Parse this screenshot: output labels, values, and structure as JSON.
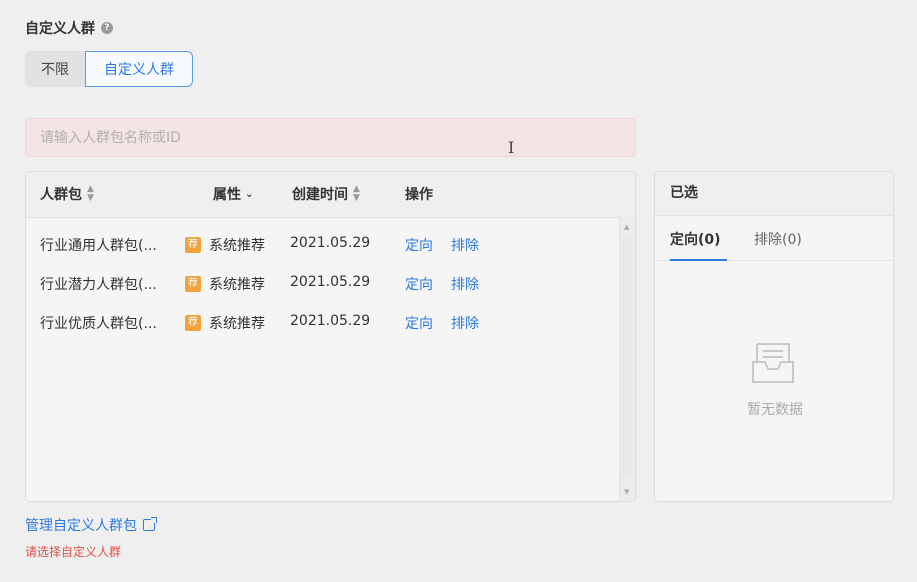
{
  "section": {
    "title": "自定义人群"
  },
  "segment": {
    "options": [
      "不限",
      "自定义人群"
    ]
  },
  "search": {
    "placeholder": "请输入人群包名称或ID"
  },
  "table": {
    "headers": [
      "人群包",
      "属性",
      "创建时间",
      "操作"
    ],
    "rows": [
      {
        "name": "行业通用人群包(...",
        "tag": "荐",
        "attr": "系统推荐",
        "date": "2021.05.29",
        "action1": "定向",
        "action2": "排除"
      },
      {
        "name": "行业潜力人群包(...",
        "tag": "荐",
        "attr": "系统推荐",
        "date": "2021.05.29",
        "action1": "定向",
        "action2": "排除"
      },
      {
        "name": "行业优质人群包(...",
        "tag": "荐",
        "attr": "系统推荐",
        "date": "2021.05.29",
        "action1": "定向",
        "action2": "排除"
      }
    ]
  },
  "selected": {
    "title": "已选",
    "tabs": [
      "定向(0)",
      "排除(0)"
    ],
    "empty_text": "暂无数据"
  },
  "footer": {
    "manage_link": "管理自定义人群包",
    "error": "请选择自定义人群"
  },
  "colors": {
    "accent": "#2d7ae0",
    "tag": "#f0a23b",
    "error": "#e0504a"
  }
}
